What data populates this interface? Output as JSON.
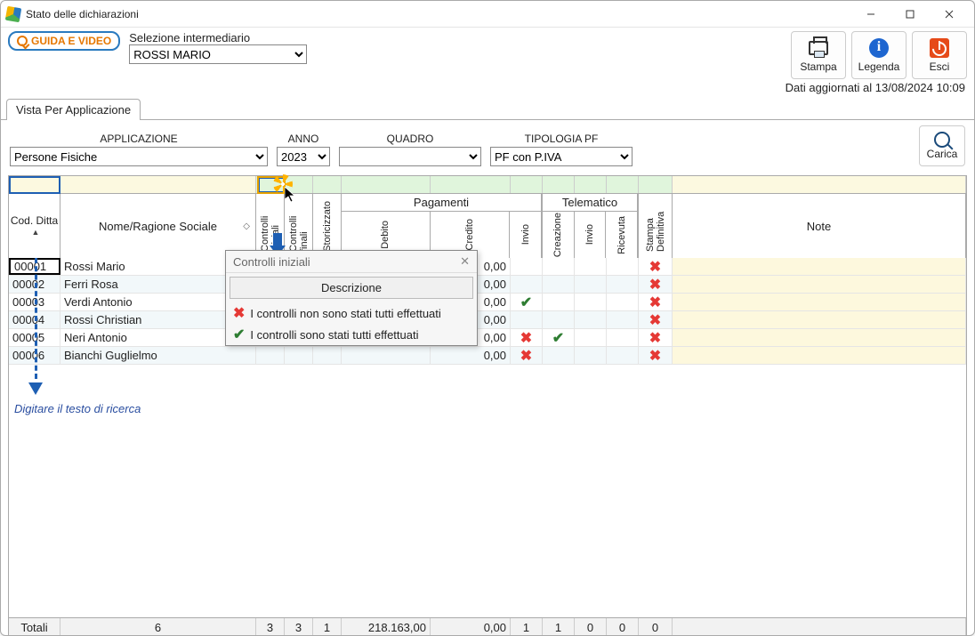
{
  "window": {
    "title": "Stato delle dichiarazioni"
  },
  "toolbar": {
    "guida_label": "GUIDA E VIDEO",
    "intermed_label": "Selezione intermediario",
    "intermed_value": "ROSSI MARIO",
    "buttons": {
      "stampa": "Stampa",
      "legenda": "Legenda",
      "esci": "Esci"
    }
  },
  "status": {
    "dati_agg": "Dati aggiornati al 13/08/2024 10:09"
  },
  "tabs": {
    "vista": "Vista Per Applicazione"
  },
  "filters": {
    "labels": {
      "app": "APPLICAZIONE",
      "anno": "ANNO",
      "quadro": "QUADRO",
      "tipo": "TIPOLOGIA PF"
    },
    "values": {
      "app": "Persone Fisiche",
      "anno": "2023",
      "quadro": "",
      "tipo": "PF con P.IVA"
    },
    "carica": "Carica"
  },
  "grid": {
    "headers": {
      "cod": "Cod. Ditta",
      "nome": "Nome/Ragione Sociale",
      "controlli_iniziali": "Controlli iniziali",
      "controlli_finali": "Controlli finali",
      "storicizzato": "Storicizzato",
      "pagamenti": "Pagamenti",
      "debito": "Debito",
      "credito": "Credito",
      "invio": "Invio",
      "telematico": "Telematico",
      "creazione": "Creazione",
      "ricevuta": "Ricevuta",
      "stampa_def": "Stampa Definitiva",
      "note": "Note"
    },
    "helper": "Digitare il testo di ricerca",
    "rows": [
      {
        "cod": "00001",
        "nome": "Rossi Mario",
        "credito": "0,00",
        "invio1": "",
        "crea": "",
        "stdef": "x"
      },
      {
        "cod": "00002",
        "nome": "Ferri Rosa",
        "credito": "0,00",
        "invio1": "",
        "crea": "",
        "stdef": "x"
      },
      {
        "cod": "00003",
        "nome": "Verdi Antonio",
        "credito": "0,00",
        "invio1": "v",
        "crea": "",
        "stdef": "x"
      },
      {
        "cod": "00004",
        "nome": "Rossi Christian",
        "credito": "0,00",
        "invio1": "",
        "crea": "",
        "stdef": "x"
      },
      {
        "cod": "00005",
        "nome": "Neri Antonio",
        "credito": "0,00",
        "invio1": "x",
        "crea": "v",
        "stdef": "x"
      },
      {
        "cod": "00006",
        "nome": "Bianchi Guglielmo",
        "credito": "0,00",
        "invio1": "x",
        "crea": "",
        "stdef": "x"
      }
    ],
    "totali": {
      "label": "Totali",
      "count": "6",
      "ci": "3",
      "cf": "3",
      "st": "1",
      "debito": "218.163,00",
      "credito": "0,00",
      "invio1": "1",
      "crea": "1",
      "invio2": "0",
      "ric": "0",
      "stdef": "0"
    }
  },
  "popup": {
    "title": "Controlli iniziali",
    "desc_header": "Descrizione",
    "row_x": "I controlli non sono stati tutti effettuati",
    "row_v": "I controlli sono stati tutti effettuati"
  }
}
